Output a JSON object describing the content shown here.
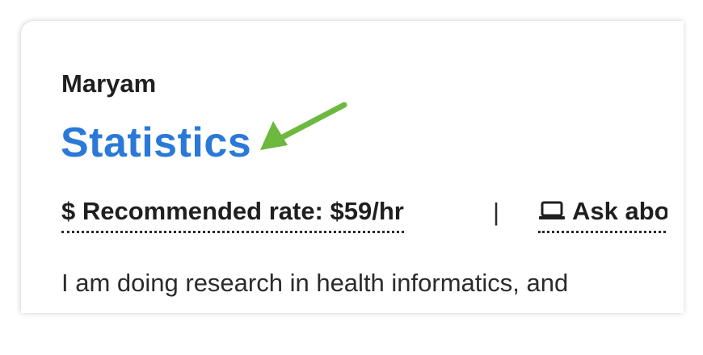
{
  "tutor": {
    "name": "Maryam",
    "subject": "Statistics",
    "rate_label": "$ Recommended rate: $59/hr",
    "separator": "|",
    "ask_label": "Ask abo",
    "bio_excerpt": "I am doing research in health informatics, and"
  },
  "annotation": {
    "arrow_color": "#6db83f",
    "points_to": "subject-link"
  },
  "colors": {
    "subject_link": "#2a79d8",
    "text": "#1f1f1f"
  },
  "icons": {
    "ask": "laptop-icon"
  }
}
